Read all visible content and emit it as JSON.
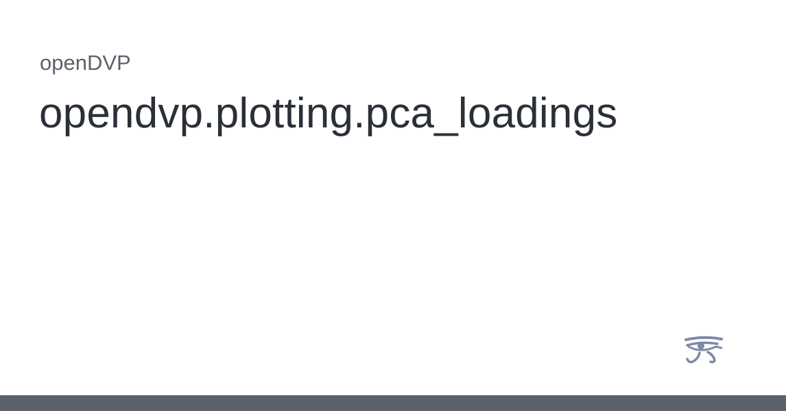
{
  "header": {
    "site_name": "openDVP"
  },
  "main": {
    "title": "opendvp.plotting.pca_loadings"
  },
  "logo": {
    "icon": "eye-of-horus-icon",
    "color": "#7d89a6"
  },
  "footer": {
    "bar_color": "#5c626c"
  }
}
